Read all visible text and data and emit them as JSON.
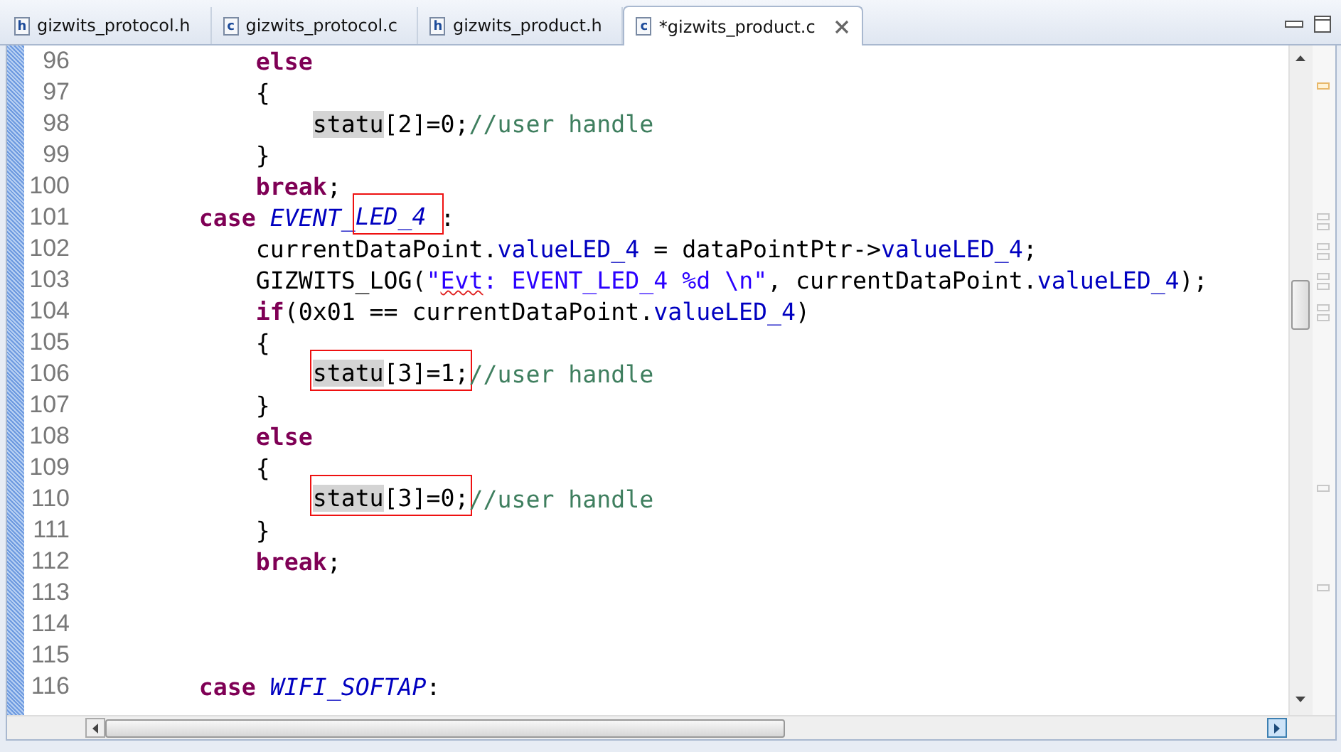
{
  "tabs": [
    {
      "label": "gizwits_protocol.h",
      "badge": "h",
      "selected": false
    },
    {
      "label": "gizwits_protocol.c",
      "badge": "c",
      "selected": false
    },
    {
      "label": "gizwits_product.h",
      "badge": "h",
      "selected": false
    },
    {
      "label": "*gizwits_product.c",
      "badge": "c",
      "selected": true
    }
  ],
  "editor": {
    "lines": [
      {
        "children": [
          {
            "number": "96",
            "tokens": [
              {
                "text": "else",
                "kind": "keyword"
              }
            ]
          },
          {
            "number": "97",
            "tokens": [
              {
                "text": "{",
                "kind": "plain"
              }
            ],
            "children": [
              {
                "number": "98",
                "tokens": [
                  {
                    "text": "statu",
                    "kind": "plain",
                    "occurrence": true
                  },
                  {
                    "text": "[2]=0;",
                    "kind": "plain"
                  },
                  {
                    "text": "//user handle",
                    "kind": "comment"
                  }
                ]
              }
            ]
          },
          {
            "number": "99",
            "tokens": [
              {
                "text": "}",
                "kind": "plain"
              }
            ]
          },
          {
            "number": "100",
            "tokens": [
              {
                "text": "break",
                "kind": "keyword"
              },
              {
                "text": ";",
                "kind": "plain"
              }
            ]
          }
        ]
      },
      {
        "number": "101",
        "tokens": [
          {
            "text": "case",
            "kind": "keyword"
          },
          {
            "text": " EVENT_",
            "kind": "constant"
          },
          {
            "text": "LED_4 ",
            "kind": "constant",
            "boxed": true
          },
          {
            "text": ":",
            "kind": "plain"
          }
        ],
        "children": [
          {
            "number": "102",
            "tokens": [
              {
                "text": "currentDataPoint.",
                "kind": "plain"
              },
              {
                "text": "valueLED_4",
                "kind": "field"
              },
              {
                "text": " = dataPointPtr->",
                "kind": "plain"
              },
              {
                "text": "valueLED_4",
                "kind": "field"
              },
              {
                "text": ";",
                "kind": "plain"
              }
            ]
          },
          {
            "number": "103",
            "tokens": [
              {
                "text": "GIZWITS_LOG(",
                "kind": "plain"
              },
              {
                "text": "\"",
                "kind": "string"
              },
              {
                "text": "Evt",
                "kind": "string",
                "misspelled": true
              },
              {
                "text": ": EVENT_LED_4 %d \\n\"",
                "kind": "string"
              },
              {
                "text": ", currentDataPoint.",
                "kind": "plain"
              },
              {
                "text": "valueLED_4",
                "kind": "field"
              },
              {
                "text": ");",
                "kind": "plain"
              }
            ]
          },
          {
            "number": "104",
            "tokens": [
              {
                "text": "if",
                "kind": "keyword"
              },
              {
                "text": "(0x01 == currentDataPoint.",
                "kind": "plain"
              },
              {
                "text": "valueLED_4",
                "kind": "field"
              },
              {
                "text": ")",
                "kind": "plain"
              }
            ]
          },
          {
            "number": "105",
            "tokens": [
              {
                "text": "{",
                "kind": "plain"
              }
            ],
            "children": [
              {
                "number": "106",
                "tokens": [
                  {
                    "text": "statu",
                    "kind": "plain",
                    "occurrence": true,
                    "boxed": true
                  },
                  {
                    "text": "[3]=1;",
                    "kind": "plain",
                    "boxed": true
                  },
                  {
                    "text": "//user handle",
                    "kind": "comment"
                  }
                ]
              }
            ]
          },
          {
            "number": "107",
            "tokens": [
              {
                "text": "}",
                "kind": "plain"
              }
            ]
          },
          {
            "number": "108",
            "tokens": [
              {
                "text": "else",
                "kind": "keyword"
              }
            ]
          },
          {
            "number": "109",
            "tokens": [
              {
                "text": "{",
                "kind": "plain"
              }
            ],
            "children": [
              {
                "number": "110",
                "tokens": [
                  {
                    "text": "statu",
                    "kind": "plain",
                    "occurrence": true,
                    "boxed": true
                  },
                  {
                    "text": "[3]=0;",
                    "kind": "plain",
                    "boxed": true
                  },
                  {
                    "text": "//user handle",
                    "kind": "comment"
                  }
                ]
              }
            ]
          },
          {
            "number": "111",
            "tokens": [
              {
                "text": "}",
                "kind": "plain"
              }
            ]
          },
          {
            "number": "112",
            "tokens": [
              {
                "text": "break",
                "kind": "keyword"
              },
              {
                "text": ";",
                "kind": "plain"
              }
            ]
          }
        ]
      },
      {
        "number": "113"
      },
      {
        "number": "114"
      },
      {
        "number": "115"
      },
      {
        "number": "116",
        "tokens": [
          {
            "text": "case",
            "kind": "keyword"
          },
          {
            "text": " WIFI_SOFTAP",
            "kind": "constant"
          },
          {
            "text": ":",
            "kind": "plain"
          }
        ]
      }
    ]
  }
}
